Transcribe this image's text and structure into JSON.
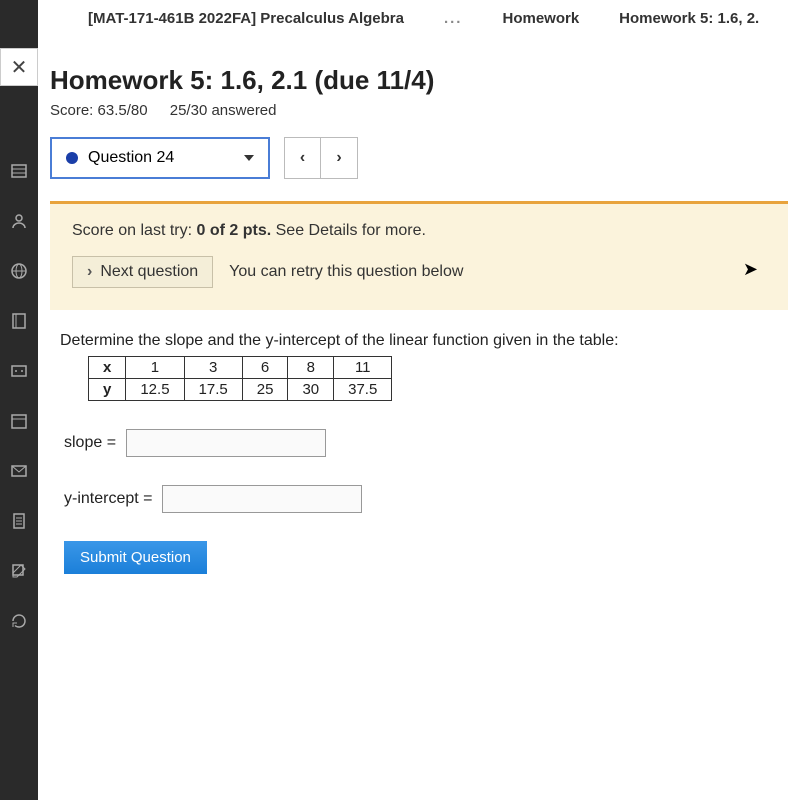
{
  "breadcrumb": {
    "course": "[MAT-171-461B 2022FA] Precalculus Algebra",
    "dots": "...",
    "link1": "Homework",
    "link2": "Homework 5: 1.6, 2."
  },
  "close_label": "✕",
  "hw_title": "Homework 5: 1.6, 2.1 (due 11/4)",
  "score": {
    "label": "Score:",
    "value": "63.5/80",
    "answered": "25/30 answered"
  },
  "question_select": {
    "label": "Question 24"
  },
  "nav": {
    "prev": "‹",
    "next": "›"
  },
  "feedback": {
    "prefix": "Score on last try: ",
    "pts": "0 of 2 pts.",
    "suffix": " See Details for more.",
    "next_label": "Next question",
    "retry": "You can retry this question below"
  },
  "question": {
    "text": "Determine the slope and the y-intercept of the linear function given in the table:",
    "table": {
      "rows": [
        {
          "h": "x",
          "v": [
            "1",
            "3",
            "6",
            "8",
            "11"
          ]
        },
        {
          "h": "y",
          "v": [
            "12.5",
            "17.5",
            "25",
            "30",
            "37.5"
          ]
        }
      ]
    },
    "slope_label": "slope =",
    "yint_label": "y-intercept =",
    "slope_value": "",
    "yint_value": "",
    "submit": "Submit Question"
  },
  "chart_data": {
    "type": "table",
    "columns": [
      "x",
      "y"
    ],
    "rows": [
      [
        1,
        12.5
      ],
      [
        3,
        17.5
      ],
      [
        6,
        25
      ],
      [
        8,
        30
      ],
      [
        11,
        37.5
      ]
    ]
  }
}
